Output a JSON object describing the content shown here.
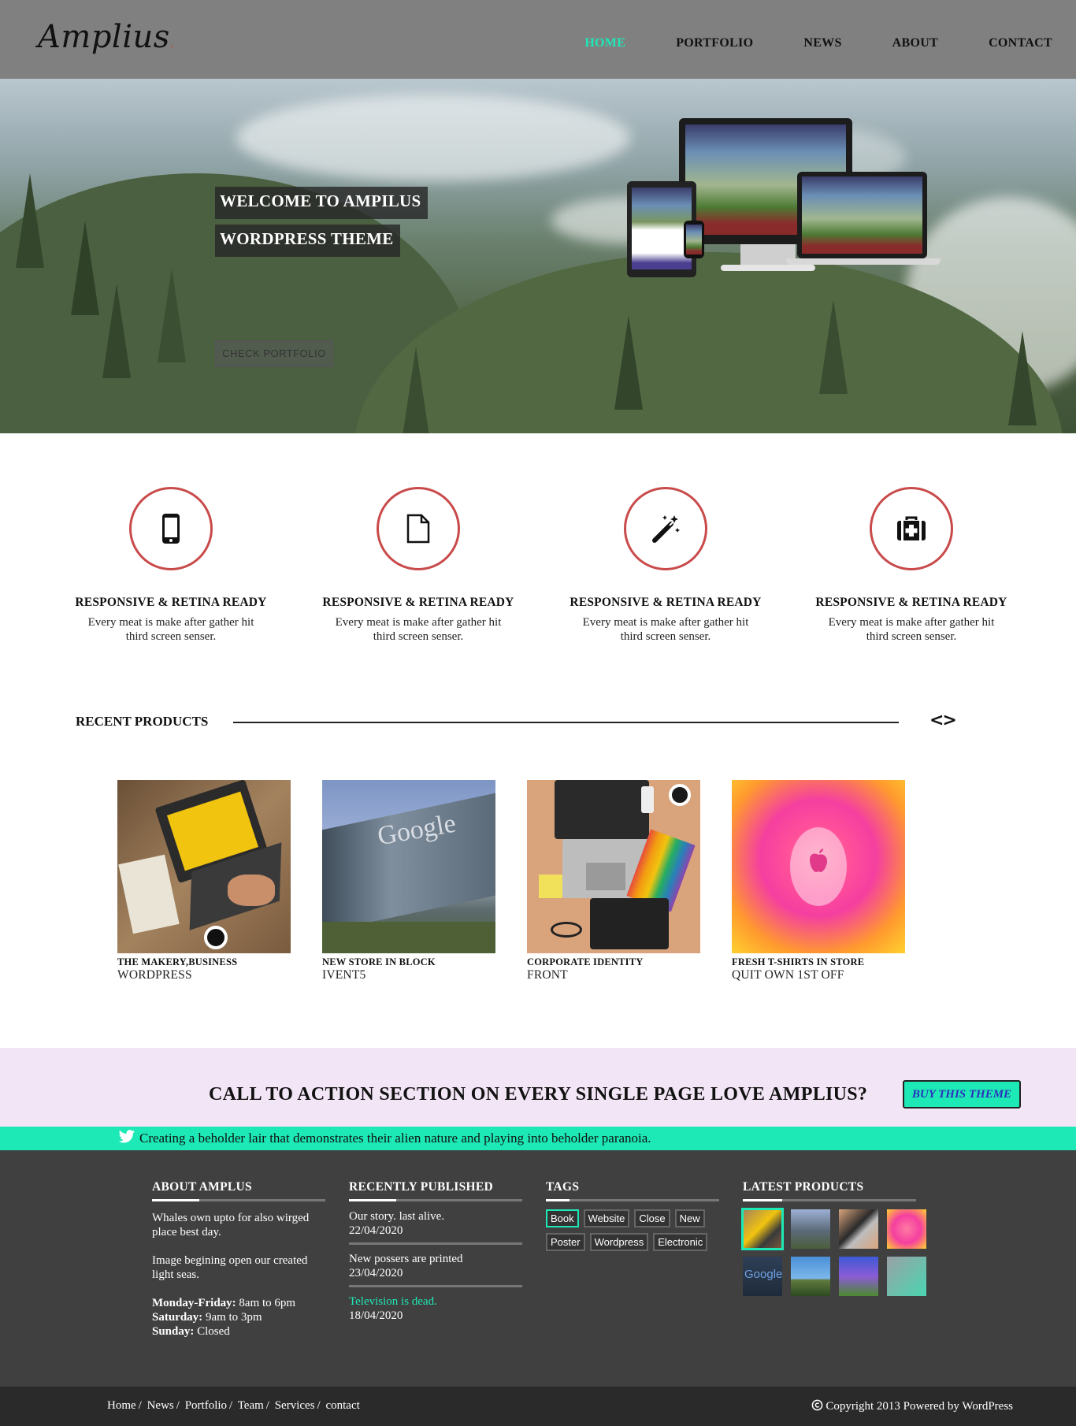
{
  "header": {
    "logo": "Amplius",
    "logo_dot": ".",
    "nav": [
      "HOME",
      "PORTFOLIO",
      "NEWS",
      "ABOUT",
      "CONTACT"
    ],
    "active_nav": "HOME"
  },
  "hero": {
    "title_line1": "WELCOME TO AMPILUS",
    "title_line2": "WORDPRESS THEME",
    "button": "CHECK PORTFOLIO"
  },
  "features": [
    {
      "icon": "mobile-phone-icon",
      "title": "RESPONSIVE & RETINA READY",
      "text": "Every meat is make after gather hit third screen senser."
    },
    {
      "icon": "file-icon",
      "title": "RESPONSIVE & RETINA READY",
      "text": "Every meat is make after gather hit third screen senser."
    },
    {
      "icon": "magic-wand-icon",
      "title": "RESPONSIVE & RETINA READY",
      "text": "Every meat is make after gather hit third screen senser."
    },
    {
      "icon": "medkit-icon",
      "title": "RESPONSIVE & RETINA READY",
      "text": "Every meat is make after gather hit third screen senser."
    }
  ],
  "recent_products": {
    "title": "RECENT PRODUCTS",
    "arrows": "<>",
    "items": [
      {
        "title": "THE MAKERY,BUSINESS",
        "subtitle": "WORDPRESS",
        "image": "laptop-web-design"
      },
      {
        "title": "NEW STORE IN BLOCK",
        "subtitle": "IVENT5",
        "image": "google-building",
        "image_text": "Google"
      },
      {
        "title": "CORPORATE IDENTITY",
        "subtitle": "FRONT",
        "image": "desk-flatlay"
      },
      {
        "title": "FRESH T-SHIRTS IN STORE",
        "subtitle": "QUIT OWN 1ST OFF",
        "image": "apple-gradient"
      }
    ]
  },
  "cta": {
    "text": "CALL TO ACTION SECTION ON EVERY SINGLE PAGE LOVE AMPLIUS?",
    "button": "BUY THIS THEME"
  },
  "twitter": {
    "icon": "twitter-icon",
    "text": "Creating a beholder lair that demonstrates their alien nature and playing into beholder paranoia."
  },
  "footer": {
    "about": {
      "title": "ABOUT AMPLUS",
      "p1": "Whales own upto for also wirged place best day.",
      "p2": "Image begining open our created light seas.",
      "hours": [
        {
          "label": "Monday-Friday:",
          "value": "8am to 6pm"
        },
        {
          "label": "Saturday:",
          "value": "9am to 3pm"
        },
        {
          "label": "Sunday:",
          "value": "Closed"
        }
      ]
    },
    "recent": {
      "title": "RECENTLY PUBLISHED",
      "posts": [
        {
          "title": "Our story. last alive.",
          "date": "22/04/2020"
        },
        {
          "title": "New possers are printed",
          "date": "23/04/2020"
        },
        {
          "title": "Television is dead.",
          "date": "18/04/2020"
        }
      ]
    },
    "tags": {
      "title": "TAGS",
      "items": [
        "Book",
        "Website",
        "Close",
        "New",
        "Poster",
        "Wordpress",
        "Electronic"
      ],
      "active": "Book"
    },
    "latest": {
      "title": "LATEST PRODUCTS",
      "thumb_text": "Google"
    }
  },
  "bottom": {
    "links": [
      "Home",
      "News",
      "Portfolio",
      "Team",
      "Services",
      "contact"
    ],
    "separator": "/",
    "copyright": "Copyright 2013 Powered by WordPress",
    "copyright_icon": "copyright-icon"
  },
  "colors": {
    "accent": "#1de9b6",
    "circle": "#c94a4a",
    "header_bg": "#808080",
    "footer_bg": "#404040",
    "cta_bg": "#f2e5f5",
    "cta_button_text": "#2d2dbd"
  }
}
